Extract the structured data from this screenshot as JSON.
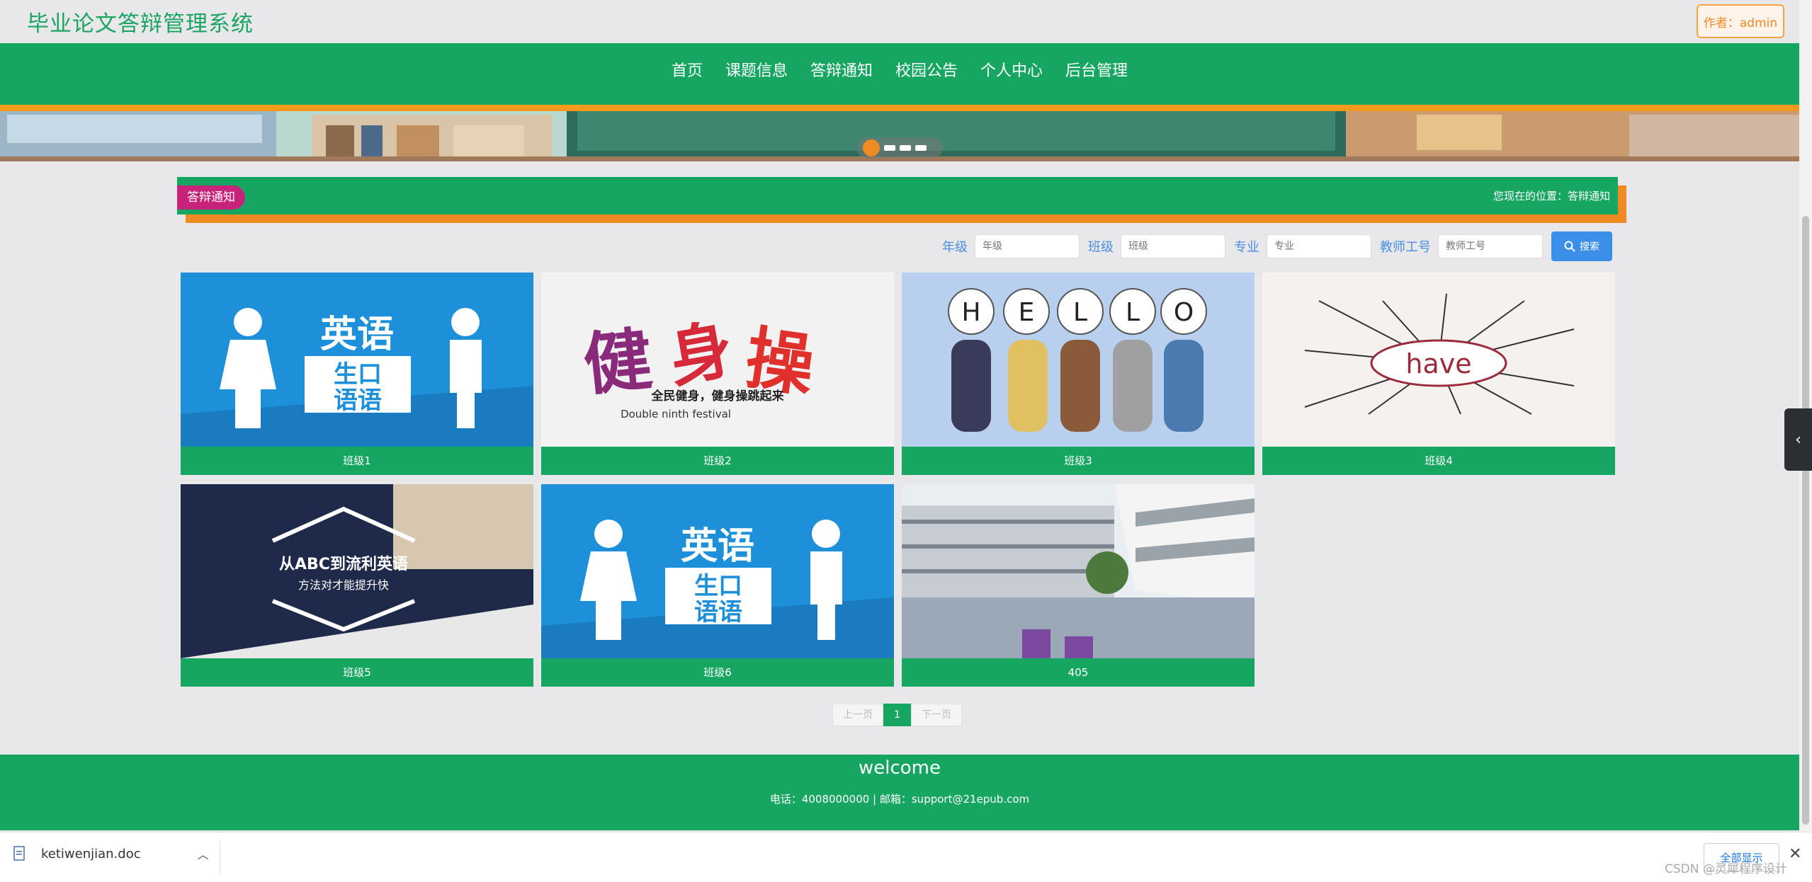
{
  "header": {
    "title": "毕业论文答辩管理系统",
    "author_label": "作者：admin"
  },
  "nav": {
    "items": [
      "首页",
      "课题信息",
      "答辩通知",
      "校园公告",
      "个人中心",
      "后台管理"
    ]
  },
  "section": {
    "tag": "答辩通知",
    "breadcrumb": "您现在的位置：答辩通知"
  },
  "search": {
    "fields": [
      {
        "label": "年级",
        "placeholder": "年级"
      },
      {
        "label": "班级",
        "placeholder": "班级"
      },
      {
        "label": "专业",
        "placeholder": "专业"
      },
      {
        "label": "教师工号",
        "placeholder": "教师工号"
      }
    ],
    "button": "搜索"
  },
  "cards": [
    {
      "caption": "班级1",
      "image": "英语 生口 语语"
    },
    {
      "caption": "班级2",
      "image": "健身操 全民健身，健身操跳起来 Double ninth festival"
    },
    {
      "caption": "班级3",
      "image": "H E L L O"
    },
    {
      "caption": "班级4",
      "image": "have"
    },
    {
      "caption": "班级5",
      "image": "从ABC到流利英语 方法对才能提升快"
    },
    {
      "caption": "班级6",
      "image": "英语 生口 语语"
    },
    {
      "caption": "405",
      "image": "campus building"
    }
  ],
  "pager": {
    "prev": "上一页",
    "current": "1",
    "next": "下一页"
  },
  "footer": {
    "title": "welcome",
    "info": "电话：4008000000 | 邮箱：support@21epub.com"
  },
  "download": {
    "filename": "ketiwenjian.doc",
    "show_all": "全部显示"
  },
  "watermark": "CSDN @灵犀程序设计",
  "colors": {
    "primary": "#16a661",
    "accent": "#f08a23",
    "tag": "#c7237b",
    "link": "#4a8ee3"
  }
}
